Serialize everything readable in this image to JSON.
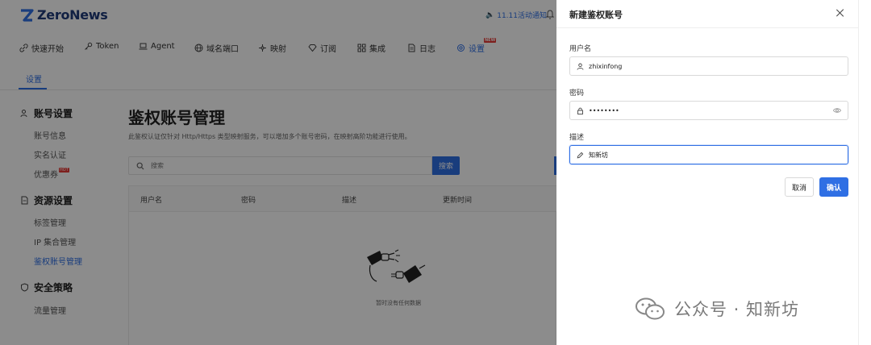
{
  "app": {
    "logo_text": "ZeroNews",
    "notice": "11.11活动通知"
  },
  "nav": {
    "items": [
      {
        "label": "快速开始",
        "icon": "link-icon"
      },
      {
        "label": "Token",
        "icon": "key-icon"
      },
      {
        "label": "Agent",
        "icon": "laptop-icon"
      },
      {
        "label": "域名端口",
        "icon": "globe-icon"
      },
      {
        "label": "映射",
        "icon": "network-icon"
      },
      {
        "label": "订阅",
        "icon": "diamond-icon"
      },
      {
        "label": "集成",
        "icon": "grid-icon"
      },
      {
        "label": "日志",
        "icon": "file-icon"
      },
      {
        "label": "设置",
        "icon": "gear-icon",
        "badge": "NEW"
      }
    ],
    "active": "设置"
  },
  "subtabs": {
    "active": "设置"
  },
  "sidebar": {
    "groups": [
      {
        "title": "账号设置",
        "icon": "user-icon",
        "items": [
          "账号信息",
          "实名认证",
          "优惠券"
        ]
      },
      {
        "title": "资源设置",
        "icon": "doc-icon",
        "items": [
          "标签管理",
          "IP 集合管理",
          "鉴权账号管理"
        ]
      },
      {
        "title": "安全策略",
        "icon": "shield-icon",
        "items": [
          "流量管理"
        ]
      }
    ],
    "coupon_badge": "HOT",
    "active_item": "鉴权账号管理"
  },
  "main": {
    "title": "鉴权账号管理",
    "description": "此鉴权认证仅针对 Http/Https 类型映射服务，可以增加多个账号密码，在映射高阶功能进行使用。",
    "search_placeholder": "搜索",
    "search_button": "搜索",
    "table_headers": [
      "用户名",
      "密码",
      "描述",
      "更新时间"
    ],
    "empty_text": "暂时没有任何数据"
  },
  "drawer": {
    "title": "新建鉴权账号",
    "username_label": "用户名",
    "username_value": "zhixinfong",
    "password_label": "密码",
    "password_value": "••••••••",
    "description_label": "描述",
    "description_value": "知新坊",
    "cancel_label": "取消",
    "ok_label": "确认"
  },
  "watermark": {
    "text": "公众号 · 知新坊"
  },
  "colors": {
    "accent": "#2f6fe4",
    "overlay": "rgba(0,0,0,0.45)",
    "badge": "#e53935"
  }
}
